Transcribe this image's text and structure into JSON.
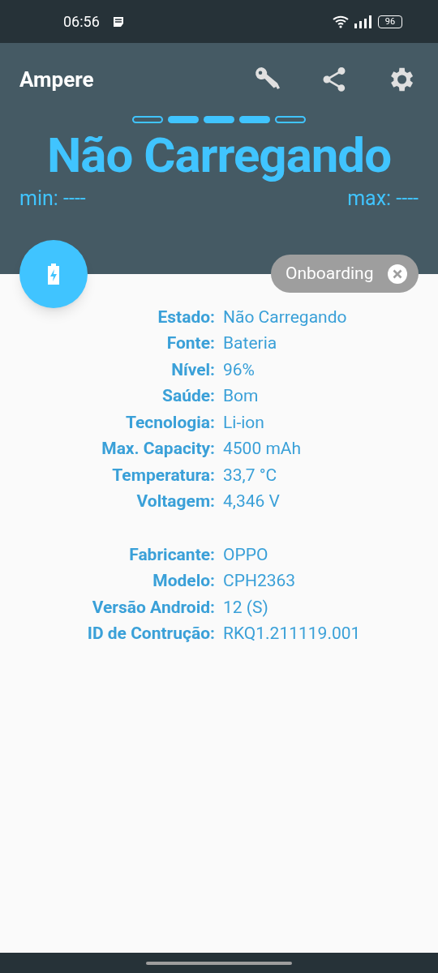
{
  "status_bar": {
    "time": "06:56",
    "battery": "96"
  },
  "app_bar": {
    "title": "Ampere"
  },
  "indicator": [
    {
      "filled": false
    },
    {
      "filled": true
    },
    {
      "filled": true
    },
    {
      "filled": true
    },
    {
      "filled": false
    }
  ],
  "status_title": "Não Carregando",
  "min": "min: ----",
  "max": "max: ----",
  "chip": {
    "label": "Onboarding"
  },
  "groups": [
    [
      {
        "label": "Estado:",
        "value": "Não Carregando"
      },
      {
        "label": "Fonte:",
        "value": "Bateria"
      },
      {
        "label": "Nível:",
        "value": "96%"
      },
      {
        "label": "Saúde:",
        "value": "Bom"
      },
      {
        "label": "Tecnologia:",
        "value": "Li-ion"
      },
      {
        "label": "Max. Capacity:",
        "value": "4500 mAh"
      },
      {
        "label": "Temperatura:",
        "value": "33,7 °C"
      },
      {
        "label": "Voltagem:",
        "value": "4,346 V"
      }
    ],
    [
      {
        "label": "Fabricante:",
        "value": "OPPO"
      },
      {
        "label": "Modelo:",
        "value": "CPH2363"
      },
      {
        "label": "Versão Android:",
        "value": "12 (S)"
      },
      {
        "label": "ID de Contrução:",
        "value": "RKQ1.211119.001"
      }
    ]
  ]
}
